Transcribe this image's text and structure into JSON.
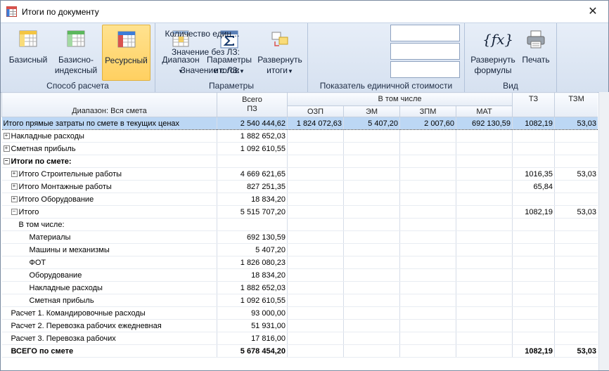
{
  "window": {
    "title": "Итоги по документу",
    "close_glyph": "✕"
  },
  "ribbon": {
    "calc_method": {
      "label": "Способ расчета",
      "buttons": [
        {
          "label": "Базисный",
          "icon": "table-yellow-icon"
        },
        {
          "label": "Базисно-\nиндексный",
          "icon": "table-green-icon"
        },
        {
          "label": "Ресурсный",
          "icon": "table-blue-icon",
          "active": true
        }
      ]
    },
    "params": {
      "label": "Параметры",
      "buttons": [
        {
          "label": "Диапазон",
          "icon": "range-icon"
        },
        {
          "label": "Параметры\nитогов",
          "icon": "sigma-icon"
        },
        {
          "label": "Развернуть\nитоги",
          "icon": "expand-totals-icon"
        }
      ]
    },
    "unit_cost": {
      "label": "Показатель единичной стоимости",
      "fields": [
        {
          "label": "Количество един…",
          "value": ""
        },
        {
          "label": "Значение без ЛЗ:",
          "value": ""
        },
        {
          "label": "Значение с ЛЗ:",
          "value": ""
        }
      ]
    },
    "view": {
      "label": "Вид",
      "buttons": [
        {
          "label": "Развернуть\nформулы",
          "icon": "fx-icon"
        },
        {
          "label": "Печать",
          "icon": "printer-icon"
        }
      ]
    }
  },
  "grid": {
    "headers": {
      "range": "Диапазон: Вся смета",
      "total": "Всего\nПЗ",
      "including": "В том числе",
      "ozp": "ОЗП",
      "em": "ЭМ",
      "zpm": "ЗПМ",
      "mat": "МАТ",
      "tz": "ТЗ",
      "tzm": "ТЗМ"
    },
    "rows": [
      {
        "name": "Итого прямые затраты по смете в текущих ценах",
        "indent": 0,
        "expander": "",
        "selected": true,
        "bold": false,
        "total": "2 540 444,62",
        "ozp": "1 824 072,63",
        "em": "5 407,20",
        "zpm": "2 007,60",
        "mat": "692 130,59",
        "tz": "1082,19",
        "tzm": "53,03"
      },
      {
        "name": "Накладные расходы",
        "indent": 0,
        "expander": "+",
        "total": "1 882 652,03"
      },
      {
        "name": "Сметная прибыль",
        "indent": 0,
        "expander": "+",
        "total": "1 092 610,55"
      },
      {
        "name": "Итоги по смете:",
        "indent": 0,
        "expander": "−",
        "bold": true,
        "total": ""
      },
      {
        "name": "Итого Строительные работы",
        "indent": 1,
        "expander": "+",
        "total": "4 669 621,65",
        "tz": "1016,35",
        "tzm": "53,03"
      },
      {
        "name": "Итого Монтажные работы",
        "indent": 1,
        "expander": "+",
        "total": "827 251,35",
        "tz": "65,84"
      },
      {
        "name": "Итого Оборудование",
        "indent": 1,
        "expander": "+",
        "total": "18 834,20"
      },
      {
        "name": "Итого",
        "indent": 1,
        "expander": "−",
        "total": "5 515 707,20",
        "tz": "1082,19",
        "tzm": "53,03"
      },
      {
        "name": "В том числе:",
        "indent": 2,
        "expander": "",
        "total": ""
      },
      {
        "name": "Материалы",
        "indent": 3,
        "expander": "",
        "total": "692 130,59"
      },
      {
        "name": "Машины и механизмы",
        "indent": 3,
        "expander": "",
        "total": "5 407,20"
      },
      {
        "name": "ФОТ",
        "indent": 3,
        "expander": "",
        "total": "1 826 080,23"
      },
      {
        "name": "Оборудование",
        "indent": 3,
        "expander": "",
        "total": "18 834,20"
      },
      {
        "name": "Накладные расходы",
        "indent": 3,
        "expander": "",
        "total": "1 882 652,03"
      },
      {
        "name": "Сметная прибыль",
        "indent": 3,
        "expander": "",
        "total": "1 092 610,55"
      },
      {
        "name": "Расчет 1.  Командировочные расходы",
        "indent": 1,
        "expander": "",
        "total": "93 000,00"
      },
      {
        "name": "Расчет 2.  Перевозка рабочих ежедневная",
        "indent": 1,
        "expander": "",
        "total": "51 931,00"
      },
      {
        "name": "Расчет 3.  Перевозка рабочих",
        "indent": 1,
        "expander": "",
        "total": "17 816,00"
      },
      {
        "name": "ВСЕГО по смете",
        "indent": 1,
        "expander": "",
        "bold": true,
        "total": "5 678 454,20",
        "tz": "1082,19",
        "tzm": "53,03"
      }
    ]
  },
  "colors": {
    "selected_row": "#bcd7f4",
    "active_button": "#ffd061",
    "ribbon_bg": "#dce6f3"
  }
}
